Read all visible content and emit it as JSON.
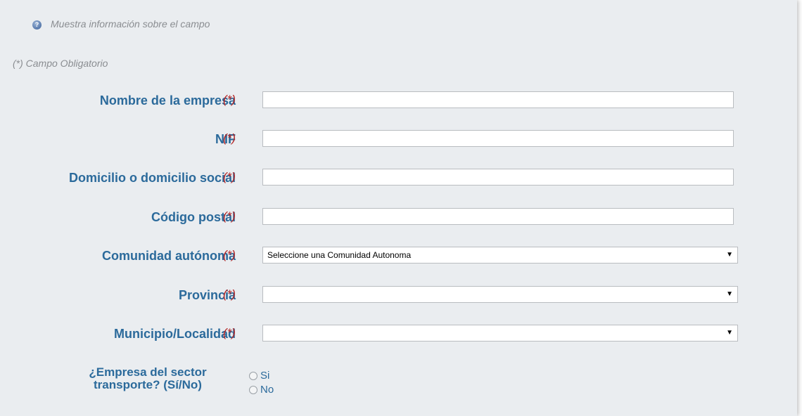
{
  "info": {
    "text": "Muestra información sobre el campo",
    "icon": "help-icon"
  },
  "required_note": "(*) Campo Obligatorio",
  "required_mark": "(*)",
  "fields": {
    "company_name": {
      "label": "Nombre de la empresa",
      "value": ""
    },
    "nif": {
      "label": "NIF",
      "value": ""
    },
    "address": {
      "label": "Domicilio o domicilio social",
      "value": ""
    },
    "postal_code": {
      "label": "Código postal",
      "value": ""
    },
    "community": {
      "label": "Comunidad autónoma",
      "selected": "Seleccione una Comunidad Autonoma"
    },
    "province": {
      "label": "Provincia",
      "selected": ""
    },
    "municipality": {
      "label": "Municipio/Localidad",
      "selected": ""
    }
  },
  "transport": {
    "label_line1": "¿Empresa del sector",
    "label_line2": "transporte? (Sí/No)",
    "options": [
      "Si",
      "No"
    ]
  },
  "select_arrow": "▼"
}
